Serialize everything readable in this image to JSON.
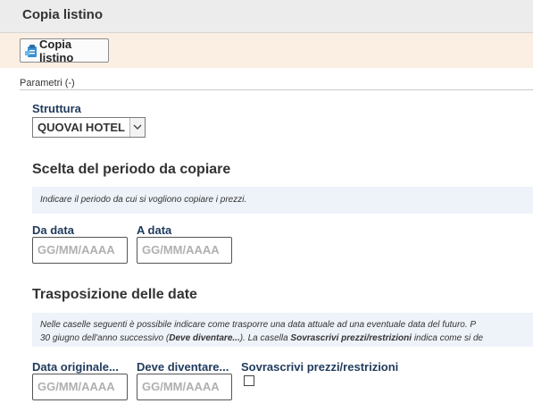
{
  "window": {
    "title": "Copia listino"
  },
  "toolbar": {
    "copy_button_label": "Copia listino",
    "copy_button_icon": "clipboard-icon"
  },
  "params": {
    "label": "Parametri (-)"
  },
  "struttura": {
    "label": "Struttura",
    "selected": "QUOVAI HOTEL"
  },
  "period_section": {
    "title": "Scelta del periodo da copiare",
    "info": "Indicare il periodo da cui si vogliono copiare i prezzi.",
    "from_label": "Da data",
    "to_label": "A data",
    "from_placeholder": "GG/MM/AAAA",
    "to_placeholder": "GG/MM/AAAA"
  },
  "transpose_section": {
    "title": "Trasposizione delle date",
    "info_line1": "Nelle caselle seguenti è possibile indicare come trasporre una data attuale ad una eventuale data del futuro. P",
    "info_line2_a": "30 giugno dell'anno successivo (",
    "info_line2_b": "Deve diventare...",
    "info_line2_c": "). La casella ",
    "info_line2_d": "Sovrascrivi prezzi/restrizioni",
    "info_line2_e": " indica come si de",
    "original_label": "Data originale...",
    "become_label": "Deve diventare...",
    "overwrite_label": "Sovrascrivi prezzi/restrizioni",
    "original_placeholder": "GG/MM/AAAA",
    "become_placeholder": "GG/MM/AAAA",
    "overwrite_checked": false
  }
}
